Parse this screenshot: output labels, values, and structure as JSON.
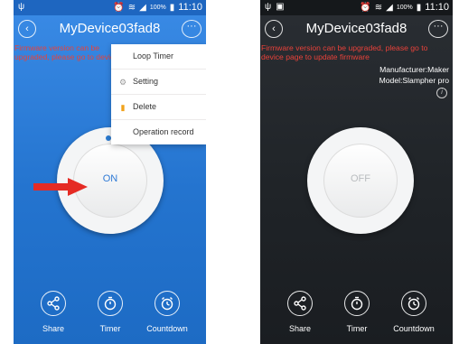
{
  "device_name": "MyDevice03fad8",
  "status_bar": {
    "battery": "100%",
    "time": "11:10"
  },
  "firmware_notice": "Firmware version can be upgraded, please go to device page to update firmware",
  "menu": {
    "items": [
      {
        "label": "Loop Timer",
        "icon": "none"
      },
      {
        "label": "Setting",
        "icon": "gear-icon"
      },
      {
        "label": "Delete",
        "icon": "trash-icon"
      },
      {
        "label": "Operation record",
        "icon": "none"
      }
    ]
  },
  "screen_on": {
    "power_label": "ON"
  },
  "screen_off": {
    "power_label": "OFF",
    "manufacturer": "Manufacturer:Maker",
    "model": "Model:Slampher pro"
  },
  "actions": {
    "share": "Share",
    "timer": "Timer",
    "countdown": "Countdown"
  },
  "colors": {
    "on_background": "#2474cf",
    "off_background": "#1f2327",
    "warning_text": "#e8423a",
    "arrow": "#e52b24"
  }
}
